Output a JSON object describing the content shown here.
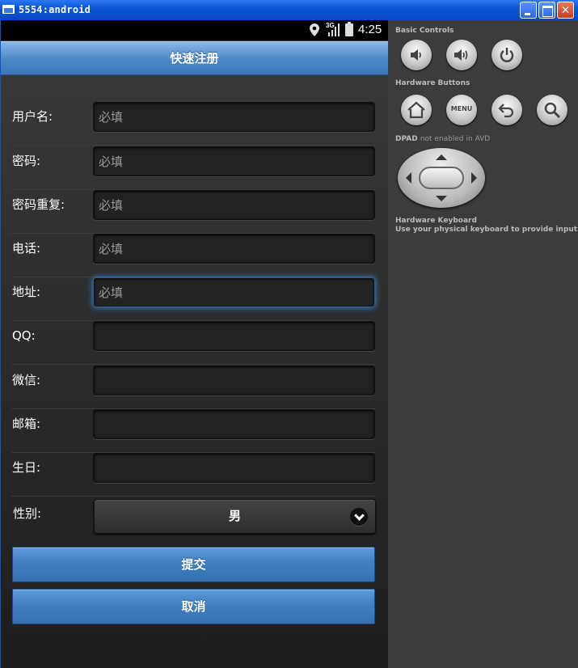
{
  "window": {
    "title": "5554:android",
    "close_glyph": "✕"
  },
  "statusbar": {
    "network": "3G",
    "time": "4:25",
    "icons": [
      "location-pin-icon",
      "signal-icon",
      "battery-icon"
    ]
  },
  "app": {
    "header_title": "快速注册",
    "fields": [
      {
        "label": "用户名:",
        "placeholder": "必填"
      },
      {
        "label": "密码:",
        "placeholder": "必填"
      },
      {
        "label": "密码重复:",
        "placeholder": "必填"
      },
      {
        "label": "电话:",
        "placeholder": "必填"
      },
      {
        "label": "地址:",
        "placeholder": "必填",
        "focused": true
      },
      {
        "label": "QQ:",
        "placeholder": ""
      },
      {
        "label": "微信:",
        "placeholder": ""
      },
      {
        "label": "邮箱:",
        "placeholder": ""
      },
      {
        "label": "生日:",
        "placeholder": ""
      }
    ],
    "gender": {
      "label": "性别:",
      "selected": "男"
    },
    "submit_label": "提交",
    "cancel_label": "取消"
  },
  "panel": {
    "basic_controls_title": "Basic Controls",
    "basic_controls": [
      "volume-down-icon",
      "volume-up-icon",
      "power-icon"
    ],
    "hardware_buttons_title": "Hardware Buttons",
    "hardware_buttons": [
      "home-icon",
      "menu",
      "back-icon",
      "search-icon"
    ],
    "menu_label": "MENU",
    "dpad_title": "DPAD",
    "dpad_note": "not enabled in AVD",
    "keyboard_title": "Hardware Keyboard",
    "keyboard_note": "Use your physical keyboard to provide input"
  },
  "colors": {
    "header_blue": "#4f8bc9",
    "button_blue": "#3f7fc0",
    "focus_glow": "#3a8fe0",
    "titlebar_blue": "#0a56d8"
  }
}
